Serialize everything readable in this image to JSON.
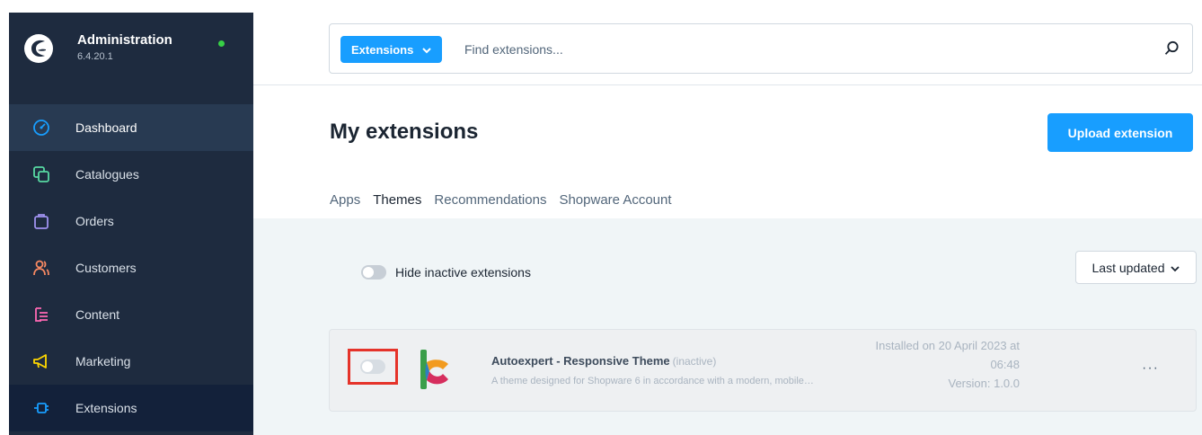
{
  "sidebar": {
    "title": "Administration",
    "version": "6.4.20.1",
    "items": [
      {
        "label": "Dashboard",
        "icon": "dashboard-icon",
        "color": "#189eff"
      },
      {
        "label": "Catalogues",
        "icon": "catalogues-icon",
        "color": "#57d9a3"
      },
      {
        "label": "Orders",
        "icon": "orders-icon",
        "color": "#a092f0"
      },
      {
        "label": "Customers",
        "icon": "customers-icon",
        "color": "#f88962"
      },
      {
        "label": "Content",
        "icon": "content-icon",
        "color": "#ff68b4"
      },
      {
        "label": "Marketing",
        "icon": "marketing-icon",
        "color": "#ffd700"
      },
      {
        "label": "Extensions",
        "icon": "extensions-icon",
        "color": "#189eff"
      }
    ]
  },
  "search": {
    "type_label": "Extensions",
    "placeholder": "Find extensions..."
  },
  "page": {
    "title": "My extensions",
    "upload_label": "Upload extension"
  },
  "tabs": [
    {
      "label": "Apps",
      "active": false
    },
    {
      "label": "Themes",
      "active": true
    },
    {
      "label": "Recommendations",
      "active": false
    },
    {
      "label": "Shopware Account",
      "active": false
    }
  ],
  "filters": {
    "hide_inactive_label": "Hide inactive extensions",
    "sort_label": "Last updated"
  },
  "extension": {
    "name": "Autoexpert - Responsive Theme",
    "status": "(inactive)",
    "description": "A theme designed for Shopware 6 in accordance with a modern, mobile…",
    "installed_line1": "Installed on 20 April 2023 at",
    "installed_line2": "06:48",
    "version": "Version: 1.0.0",
    "menu": "···"
  },
  "colors": {
    "accent": "#189eff",
    "sidebar_bg": "#1e2b3f",
    "highlight_border": "#e5332a",
    "status_online": "#37d046"
  }
}
